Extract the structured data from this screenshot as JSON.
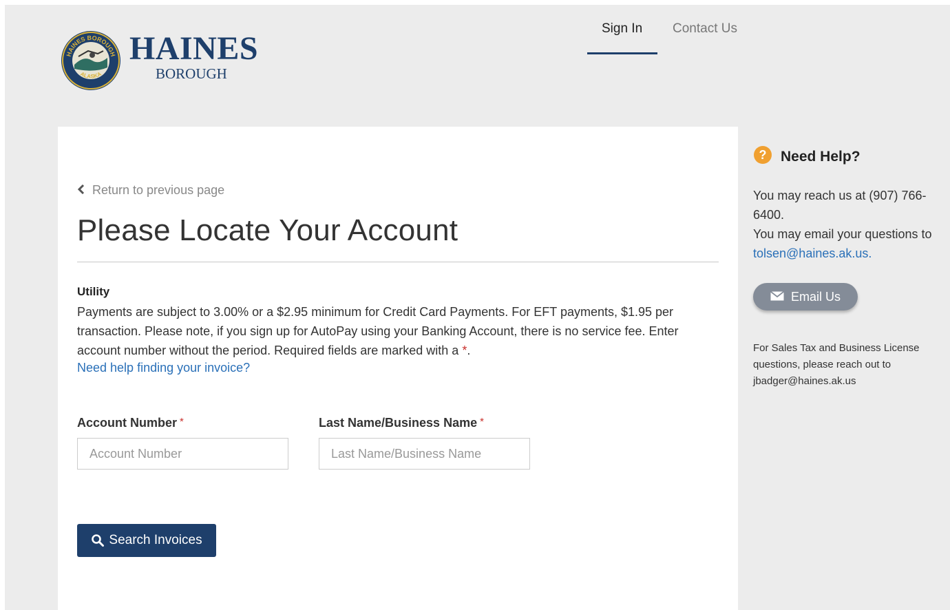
{
  "header": {
    "brand_name": "HAINES",
    "brand_sub": "BOROUGH",
    "seal_text_top": "HAINES BOROUGH",
    "seal_text_bottom": "ALASKA",
    "nav": {
      "signin": "Sign In",
      "contact": "Contact Us",
      "active": "Sign In"
    }
  },
  "main": {
    "back_link": "Return to previous page",
    "title": "Please Locate Your Account",
    "section_label": "Utility",
    "info_text": "Payments are subject to 3.00% or a $2.95 minimum for Credit Card Payments. For EFT payments, $1.95 per transaction. Please note, if you sign up for AutoPay using your Banking Account, there is no service fee. Enter account number without the period.  Required fields are marked with a ",
    "required_marker": "*",
    "info_end": ".",
    "help_link": "Need help finding your invoice?",
    "fields": {
      "account_label": "Account Number",
      "account_placeholder": "Account Number",
      "account_value": "",
      "name_label": "Last Name/Business Name",
      "name_placeholder": "Last Name/Business Name",
      "name_value": ""
    },
    "search_button": "Search Invoices"
  },
  "sidebar": {
    "title": "Need Help?",
    "text_before": "You may reach us at (907) 766-6400.",
    "text_email_intro": "You may email your questions to",
    "email": "tolsen@haines.ak.us",
    "email_end": ".",
    "email_button": "Email Us",
    "sales_note": "For Sales Tax and Business License questions, please reach out to jbadger@haines.ak.us"
  },
  "colors": {
    "brand": "#1e3f6b",
    "link": "#2a70b8",
    "required": "#c9302c",
    "help_icon": "#f0a030",
    "page_bg": "#ececec"
  },
  "icons": {
    "back": "chevron-left-icon",
    "search": "search-icon",
    "help": "question-circle-icon",
    "email": "envelope-icon"
  }
}
